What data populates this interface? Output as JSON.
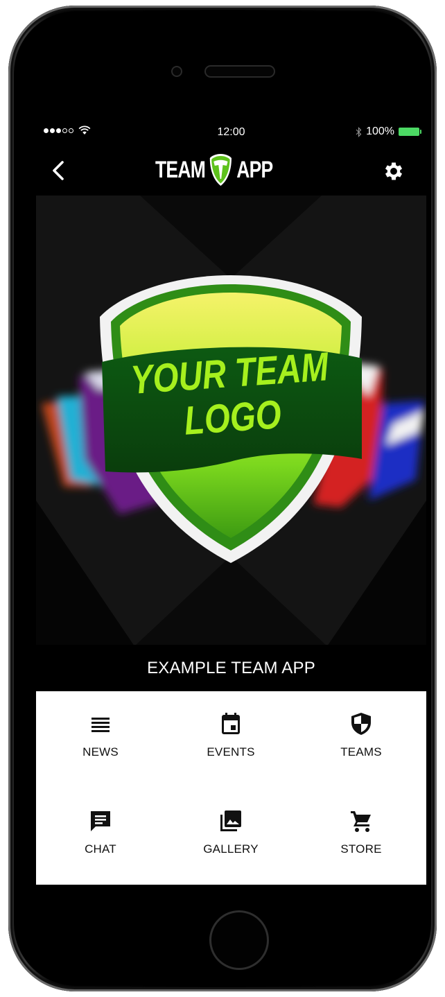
{
  "status_bar": {
    "time": "12:00",
    "battery": "100%"
  },
  "nav": {
    "title_left": "TEAM",
    "title_right": "APP"
  },
  "hero": {
    "logo_line1": "YOUR TEAM",
    "logo_line2": "LOGO"
  },
  "team_name": "EXAMPLE TEAM APP",
  "menu": {
    "items": [
      {
        "label": "NEWS",
        "icon": "list-icon"
      },
      {
        "label": "EVENTS",
        "icon": "calendar-icon"
      },
      {
        "label": "TEAMS",
        "icon": "shield-icon"
      },
      {
        "label": "CHAT",
        "icon": "chat-icon"
      },
      {
        "label": "GALLERY",
        "icon": "gallery-icon"
      },
      {
        "label": "STORE",
        "icon": "cart-icon"
      }
    ]
  },
  "colors": {
    "accent_green": "#6ad61e",
    "battery_green": "#4cd964",
    "background": "#000000",
    "menu_background": "#ffffff"
  }
}
